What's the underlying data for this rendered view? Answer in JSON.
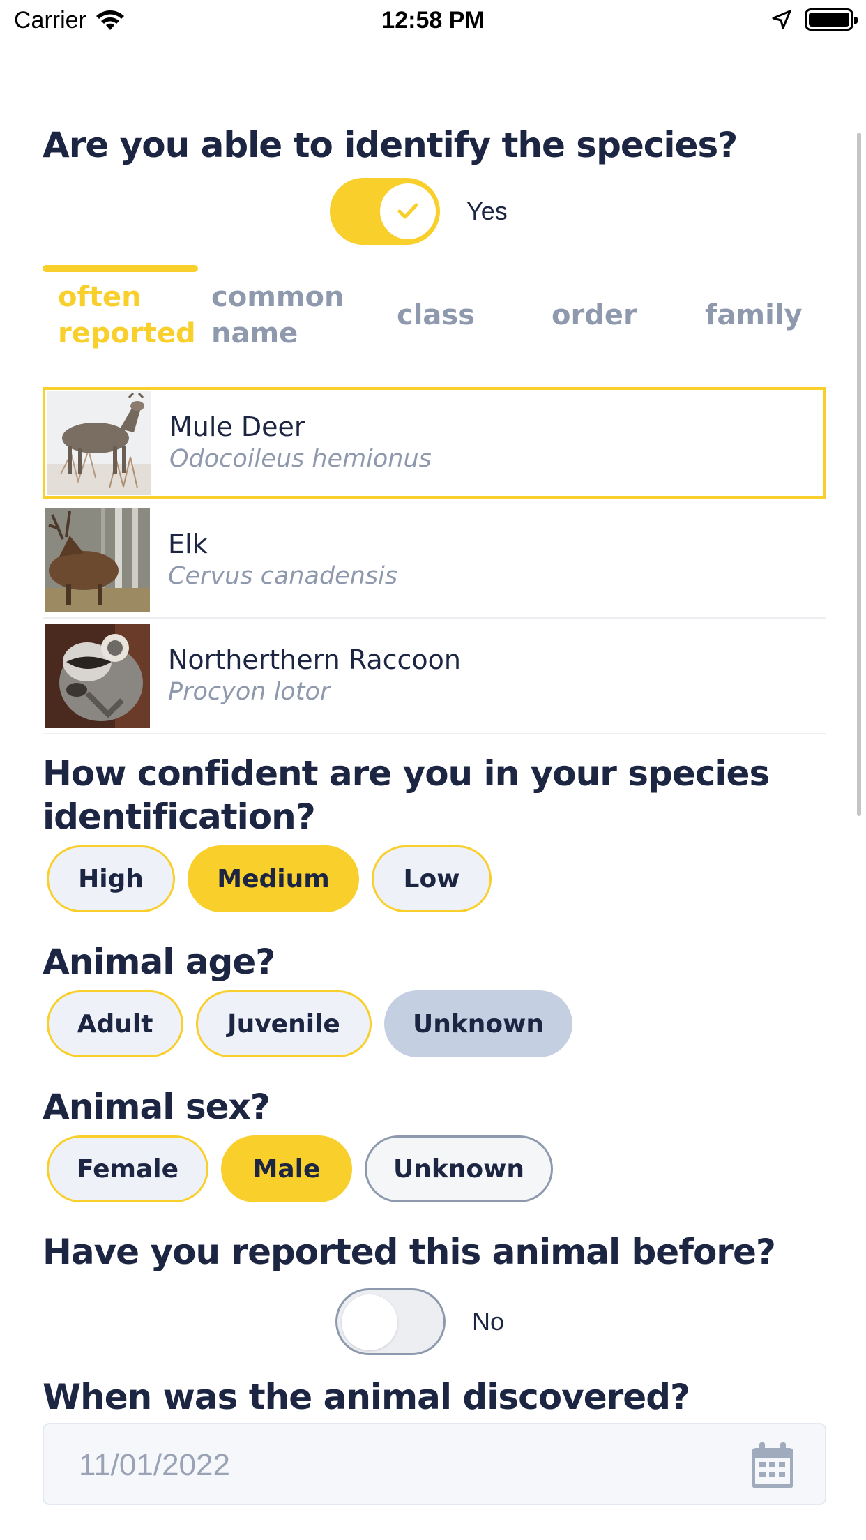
{
  "status_bar": {
    "carrier": "Carrier",
    "time": "12:58 PM"
  },
  "identify": {
    "question": "Are you able to identify the species?",
    "toggle_label": "Yes"
  },
  "tabs": [
    {
      "label": "often reported",
      "active": true
    },
    {
      "label": "common name"
    },
    {
      "label": "class"
    },
    {
      "label": "order"
    },
    {
      "label": "family"
    }
  ],
  "species": [
    {
      "common": "Mule Deer",
      "latin": "Odocoileus hemionus",
      "selected": true
    },
    {
      "common": "Elk",
      "latin": "Cervus canadensis"
    },
    {
      "common": "Northerthern Raccoon",
      "latin": "Procyon lotor"
    }
  ],
  "confidence": {
    "question": "How confident are you in your species identification?",
    "options": [
      "High",
      "Medium",
      "Low"
    ],
    "selected": "Medium"
  },
  "age": {
    "question": "Animal age?",
    "options": [
      "Adult",
      "Juvenile",
      "Unknown"
    ],
    "selected": "Unknown"
  },
  "sex": {
    "question": "Animal sex?",
    "options": [
      "Female",
      "Male",
      "Unknown"
    ],
    "selected": "Male"
  },
  "reported_before": {
    "question": "Have you reported this animal before?",
    "toggle_label": "No"
  },
  "discovered": {
    "question": "When was the animal discovered?",
    "date_value": "11/01/2022"
  },
  "colors": {
    "accent": "#f9cf2c",
    "text": "#1c2541",
    "muted": "#8e99ad",
    "chip_bg": "#eef1f8"
  }
}
